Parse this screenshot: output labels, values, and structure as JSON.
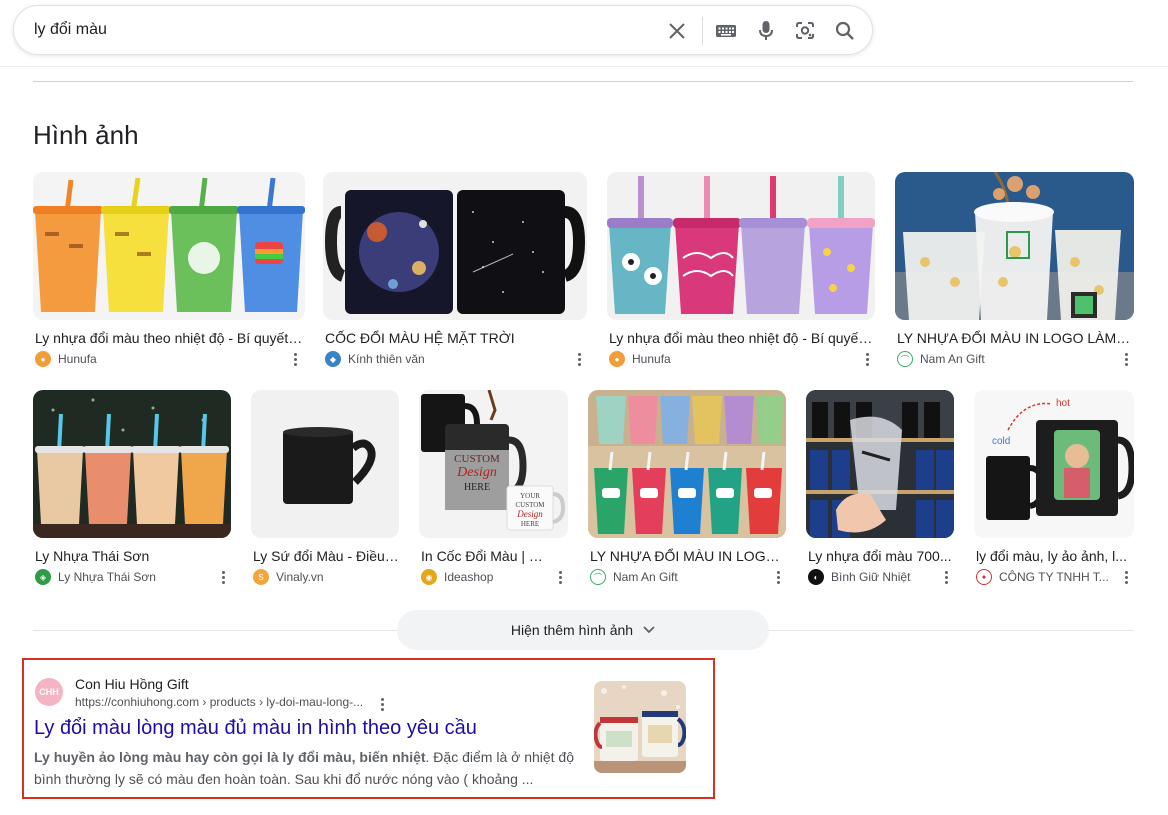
{
  "search": {
    "query": "ly đổi màu"
  },
  "images_section": {
    "title": "Hình ảnh",
    "row1": [
      {
        "title": "Ly nhựa đổi màu theo nhiệt độ - Bí quyết ...",
        "source": "Hunufa"
      },
      {
        "title": "CỐC ĐỔI MÀU HỆ MẶT TRỜI",
        "source": "Kính thiên văn"
      },
      {
        "title": "Ly nhựa đổi màu theo nhiệt độ - Bí quyết ...",
        "source": "Hunufa"
      },
      {
        "title": "LY NHỰA ĐỔI MÀU IN LOGO LÀM QUÀ ...",
        "source": "Nam An Gift"
      }
    ],
    "row2": [
      {
        "title": "Ly Nhựa Thái Sơn",
        "source": "Ly Nhựa Thái Sơn"
      },
      {
        "title": "Ly Sứ đổi Màu - Điều ...",
        "source": "Vinaly.vn"
      },
      {
        "title": "In Cốc Đổi Màu | Ly ...",
        "source": "Ideashop"
      },
      {
        "title": "LY NHỰA ĐỔI MÀU IN LOGO ...",
        "source": "Nam An Gift"
      },
      {
        "title": "Ly nhựa đổi màu 700...",
        "source": "Bình Giữ Nhiệt"
      },
      {
        "title": "ly đổi màu, ly ảo ảnh, l...",
        "source": "CÔNG TY TNHH T..."
      }
    ],
    "more_button": "Hiện thêm hình ảnh"
  },
  "result": {
    "site_name": "Con Hiu Hồng Gift",
    "favicon_text": "CHH",
    "url": "https://conhiuhong.com › products › ly-doi-mau-long-...",
    "title": "Ly đổi màu lòng màu đủ màu in hình theo yêu cầu",
    "snippet_bold": "Ly huyền ảo lòng màu hay còn gọi là ly đổi màu, biến nhiệt",
    "snippet_rest": ". Đặc điểm là ở nhiệt độ bình thường ly sẽ có màu đen hoàn toàn. Sau khi đổ nước nóng vào ( khoảng ..."
  },
  "colors": {
    "link": "#1a0dab",
    "highlight_border": "#d93025",
    "hunufa_favicon": "#f29e38",
    "kinh_favicon": "#3b82c4"
  },
  "icons": [
    "close-icon",
    "keyboard-icon",
    "mic-icon",
    "lens-icon",
    "search-icon",
    "chevron-down-icon",
    "more-vert-icon"
  ]
}
